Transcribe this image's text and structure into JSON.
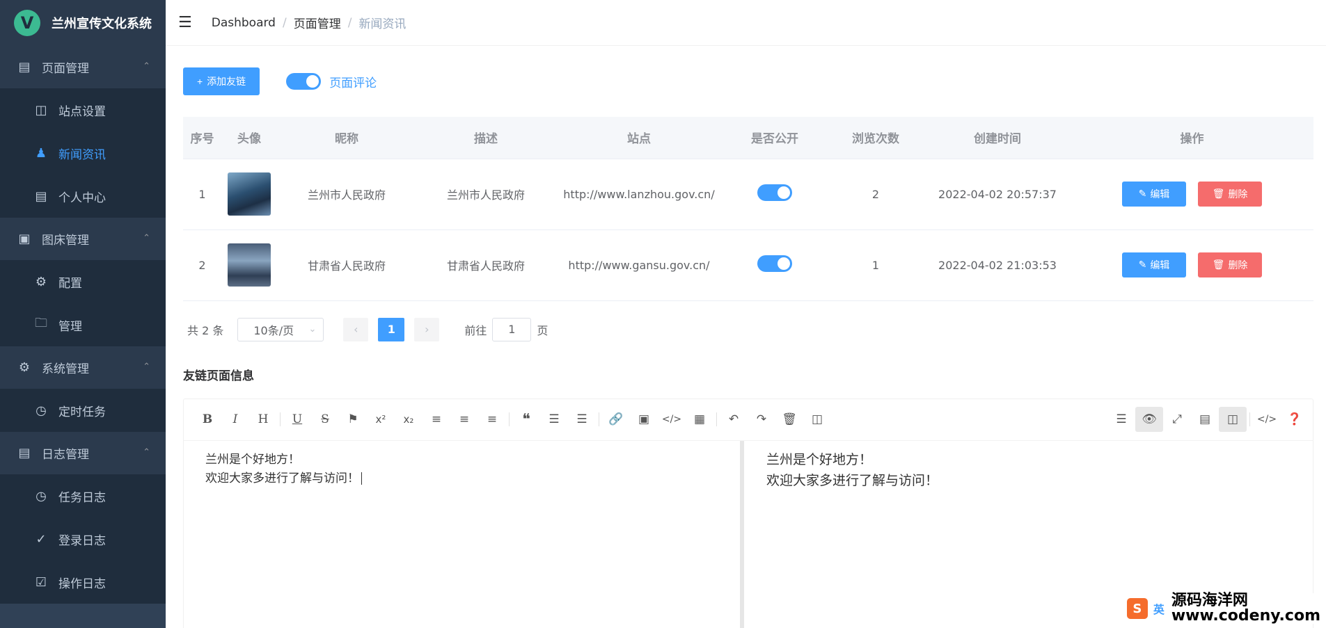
{
  "app": {
    "title": "兰州宣传文化系统",
    "logo_letter": "V"
  },
  "sidebar": {
    "groups": [
      {
        "label": "页面管理",
        "icon": "file-icon",
        "items": [
          {
            "label": "站点设置",
            "icon": "sitemap-icon"
          },
          {
            "label": "新闻资讯",
            "icon": "user-icon"
          },
          {
            "label": "个人中心",
            "icon": "document-icon"
          }
        ]
      },
      {
        "label": "图床管理",
        "icon": "image-icon",
        "items": [
          {
            "label": "配置",
            "icon": "gear-icon"
          },
          {
            "label": "管理",
            "icon": "folder-icon"
          }
        ]
      },
      {
        "label": "系统管理",
        "icon": "cog-icon",
        "items": [
          {
            "label": "定时任务",
            "icon": "alarm-icon"
          }
        ]
      },
      {
        "label": "日志管理",
        "icon": "log-icon",
        "items": [
          {
            "label": "任务日志",
            "icon": "alarm-icon"
          },
          {
            "label": "登录日志",
            "icon": "check-list-icon"
          },
          {
            "label": "操作日志",
            "icon": "checkbox-doc-icon"
          }
        ]
      }
    ],
    "active_item": "新闻资讯"
  },
  "breadcrumb": [
    "Dashboard",
    "页面管理",
    "新闻资讯"
  ],
  "toolbar": {
    "add_label": "添加友链",
    "switch_label": "页面评论"
  },
  "table": {
    "columns": [
      "序号",
      "头像",
      "昵称",
      "描述",
      "站点",
      "是否公开",
      "浏览次数",
      "创建时间",
      "操作"
    ],
    "rows": [
      {
        "index": "1",
        "nickname": "兰州市人民政府",
        "desc": "兰州市人民政府",
        "site": "http://www.lanzhou.gov.cn/",
        "views": "2",
        "created": "2022-04-02 20:57:37"
      },
      {
        "index": "2",
        "nickname": "甘肃省人民政府",
        "desc": "甘肃省人民政府",
        "site": "http://www.gansu.gov.cn/",
        "views": "1",
        "created": "2022-04-02 21:03:53"
      }
    ],
    "edit_label": "编辑",
    "delete_label": "删除"
  },
  "pager": {
    "total": "共 2 条",
    "size": "10条/页",
    "current": "1",
    "goto_prefix": "前往",
    "goto_value": "1",
    "goto_suffix": "页"
  },
  "section": {
    "title": "友链页面信息"
  },
  "editor": {
    "lines": [
      "兰州是个好地方！",
      "欢迎大家多进行了解与访问！"
    ]
  },
  "watermark": {
    "logo": "S",
    "en": "英",
    "cn": "源码海洋网",
    "url": "www.codeny.com"
  },
  "colors": {
    "primary": "#409eff",
    "danger": "#f56c6c",
    "sidebar": "#304156",
    "sidebar_sub": "#1f2d3d"
  }
}
